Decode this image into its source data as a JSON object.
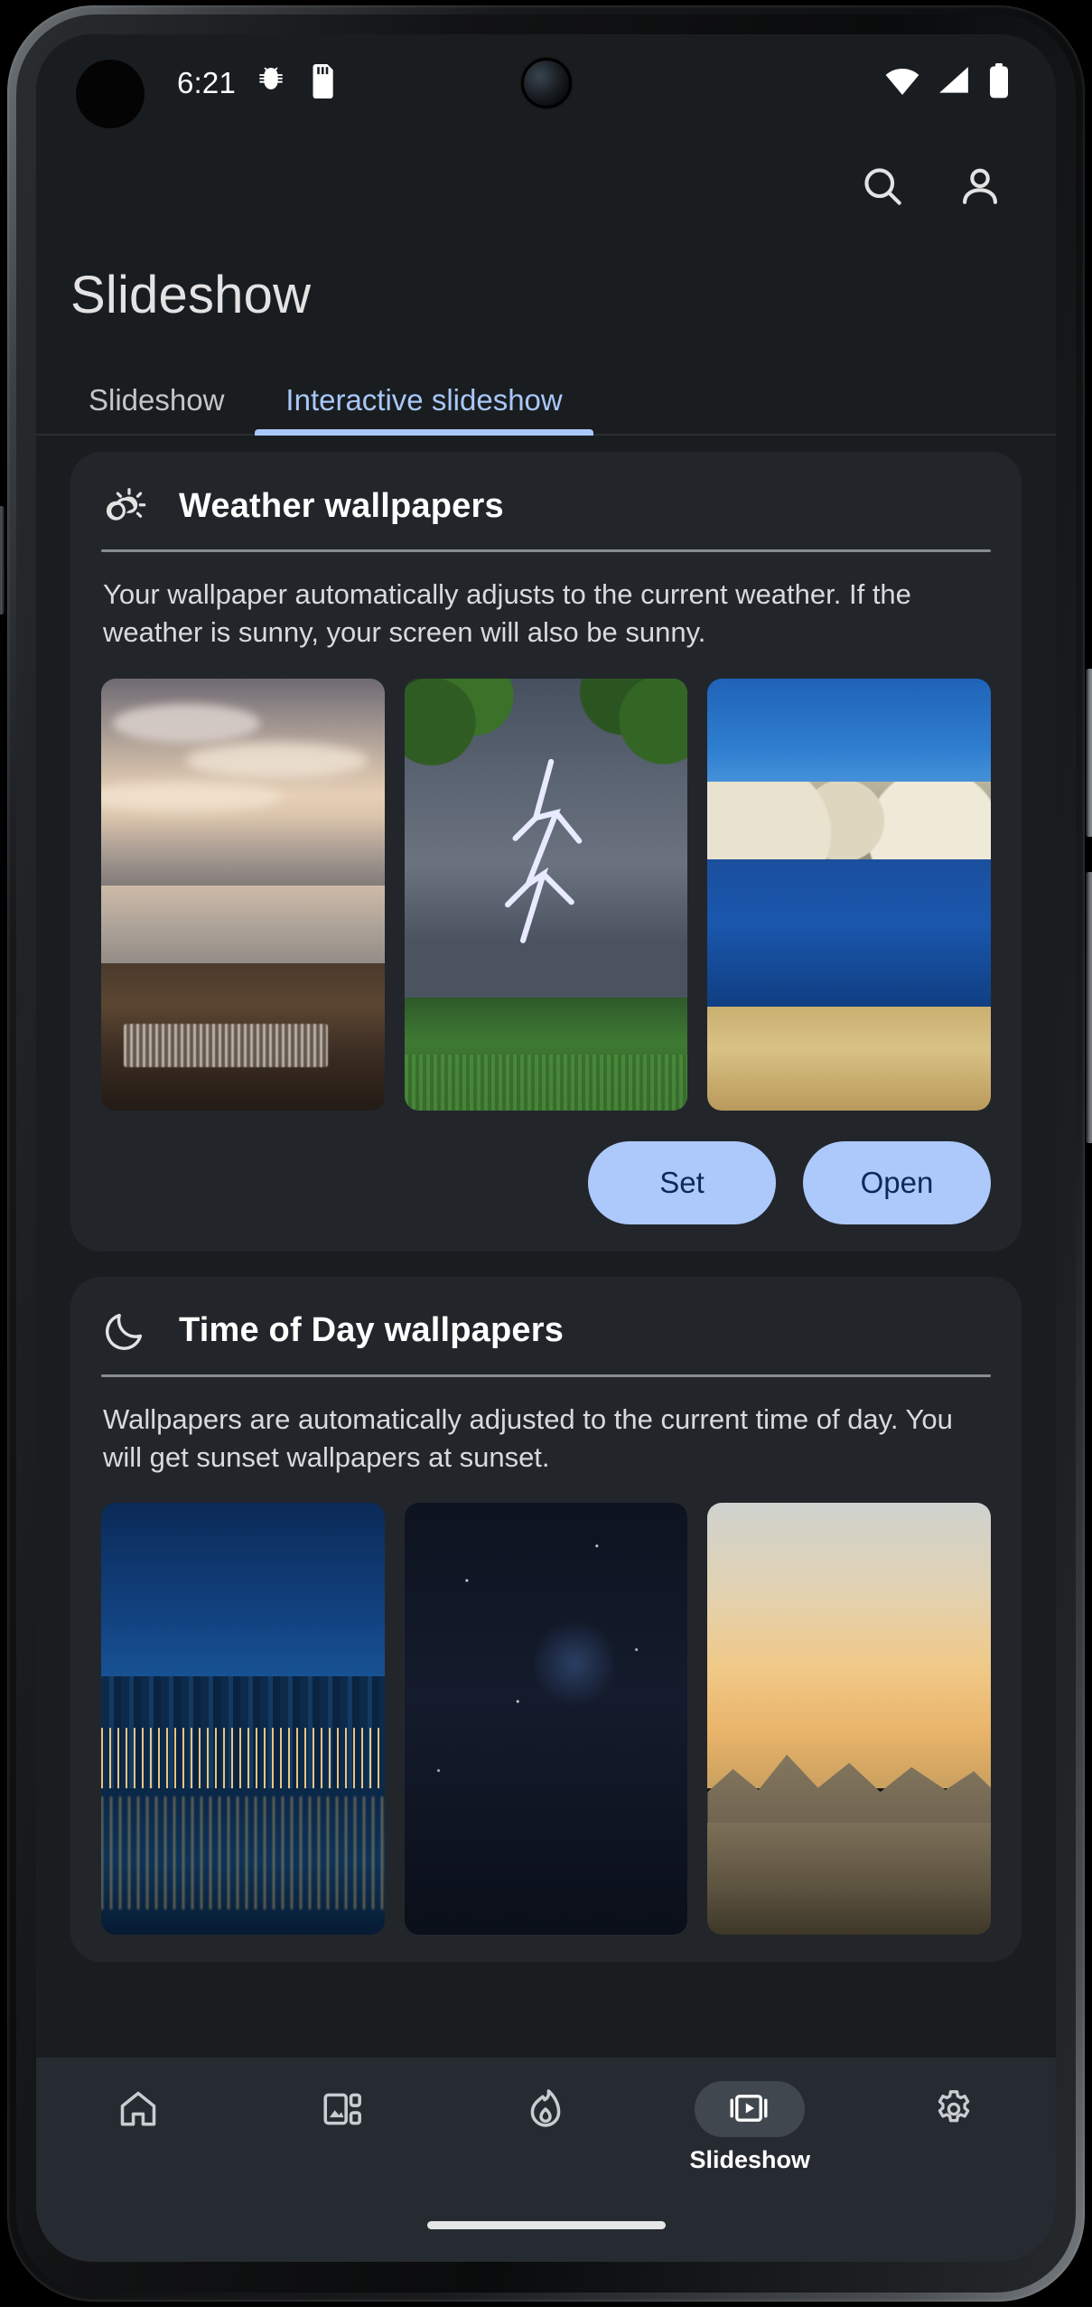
{
  "status_bar": {
    "time": "6:21",
    "icons": [
      "android-bug-icon",
      "sd-card-icon"
    ],
    "right_icons": [
      "wifi-icon",
      "cellular-signal-icon",
      "battery-icon"
    ]
  },
  "app_bar": {
    "search_icon": "search-icon",
    "account_icon": "account-circle-icon"
  },
  "header": {
    "title": "Slideshow"
  },
  "tabs": [
    {
      "label": "Slideshow",
      "active": false
    },
    {
      "label": "Interactive slideshow",
      "active": true
    }
  ],
  "cards": [
    {
      "icon": "partly-cloudy-sun-icon",
      "title": "Weather wallpapers",
      "description": "Your wallpaper automatically adjusts to the current weather. If the weather is sunny, your screen will also be sunny.",
      "thumbnails": [
        "coastal-sunset-wallpaper",
        "lightning-storm-wallpaper",
        "blue-lake-wallpaper"
      ],
      "buttons": [
        {
          "label": "Set"
        },
        {
          "label": "Open"
        }
      ]
    },
    {
      "icon": "crescent-moon-icon",
      "title": "Time of Day wallpapers",
      "description": "Wallpapers are automatically adjusted to the current time of day. You will get sunset wallpapers at sunset.",
      "thumbnails": [
        "city-night-skyline-wallpaper",
        "dark-night-sky-wallpaper",
        "golden-sunset-mountains-wallpaper"
      ],
      "buttons": []
    }
  ],
  "bottom_nav": [
    {
      "icon": "home-icon",
      "label": "",
      "active": false
    },
    {
      "icon": "collections-icon",
      "label": "",
      "active": false
    },
    {
      "icon": "flame-icon",
      "label": "",
      "active": false
    },
    {
      "icon": "slideshow-icon",
      "label": "Slideshow",
      "active": true
    },
    {
      "icon": "settings-gear-icon",
      "label": "",
      "active": false
    }
  ],
  "colors": {
    "background": "#1a1d1f",
    "card": "#22262b",
    "accent": "#a8c7fa",
    "button_bg": "#adc9fb",
    "button_text": "#0b2a58",
    "nav_bg": "#262b31",
    "nav_pill": "#41474e"
  }
}
